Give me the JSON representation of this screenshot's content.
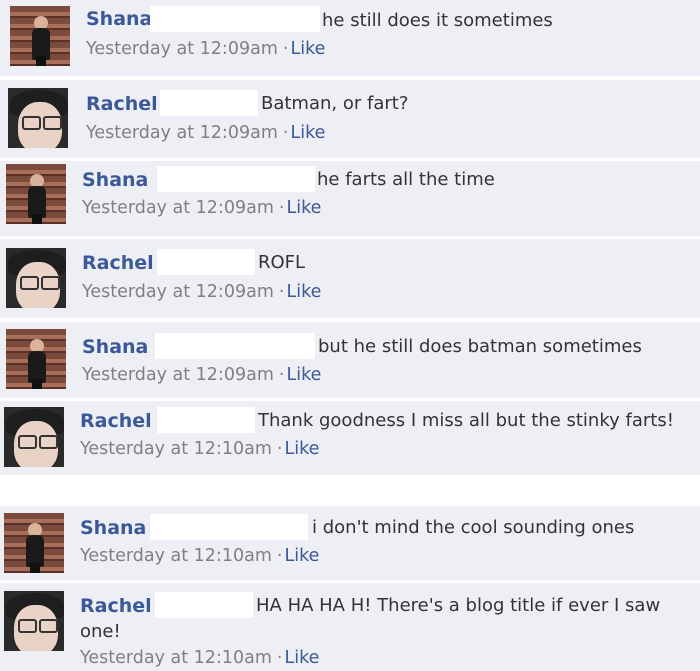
{
  "colors": {
    "name": "#3b5998",
    "link": "#3b5998",
    "meta": "#808080",
    "text": "#333333",
    "background": "#edeff4"
  },
  "comments": [
    {
      "author": "Shana",
      "avatar": "shana-avatar",
      "message": "he still does it sometimes",
      "timestamp": "Yesterday at 12:09am",
      "separator": "·",
      "like": "Like"
    },
    {
      "author": "Rachel",
      "avatar": "rachel-avatar",
      "message": "Batman, or fart?",
      "timestamp": "Yesterday at 12:09am",
      "separator": "·",
      "like": "Like"
    },
    {
      "author": "Shana",
      "avatar": "shana-avatar",
      "message": "he farts all the time",
      "timestamp": "Yesterday at 12:09am",
      "separator": "·",
      "like": "Like"
    },
    {
      "author": "Rachel",
      "avatar": "rachel-avatar",
      "message": "ROFL",
      "timestamp": "Yesterday at 12:09am",
      "separator": "·",
      "like": "Like"
    },
    {
      "author": "Shana",
      "avatar": "shana-avatar",
      "message": "but he still does batman sometimes",
      "timestamp": "Yesterday at 12:09am",
      "separator": "·",
      "like": "Like"
    },
    {
      "author": "Rachel",
      "avatar": "rachel-avatar",
      "message": "Thank goodness I miss all but the stinky farts!",
      "timestamp": "Yesterday at 12:10am",
      "separator": "·",
      "like": "Like"
    },
    {
      "author": "Shana",
      "avatar": "shana-avatar",
      "message": "i don't mind the cool sounding ones",
      "timestamp": "Yesterday at 12:10am",
      "separator": "·",
      "like": "Like"
    },
    {
      "author": "Rachel",
      "avatar": "rachel-avatar",
      "message": "HA HA HA H! There's a blog title if ever I saw one!",
      "timestamp": "Yesterday at 12:10am",
      "separator": "·",
      "like": "Like"
    }
  ]
}
